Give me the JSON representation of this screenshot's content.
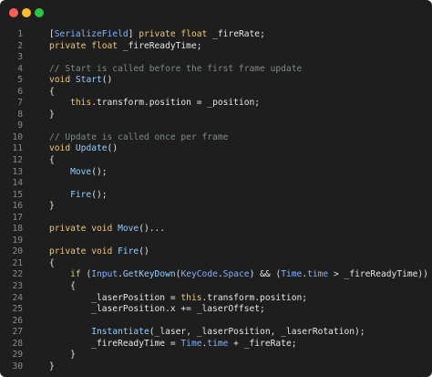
{
  "window": {
    "traffic_lights": {
      "close": "#ff5f57",
      "minimize": "#febc2e",
      "zoom": "#28c840"
    }
  },
  "code": {
    "lines": [
      {
        "n": "1",
        "segments": [
          {
            "t": "[",
            "c": "id"
          },
          {
            "t": "SerializeField",
            "c": "type"
          },
          {
            "t": "] ",
            "c": "id"
          },
          {
            "t": "private float",
            "c": "kw"
          },
          {
            "t": " _fireRate;",
            "c": "id"
          }
        ]
      },
      {
        "n": "2",
        "segments": [
          {
            "t": "private float",
            "c": "kw"
          },
          {
            "t": " _fireReadyTime;",
            "c": "id"
          }
        ]
      },
      {
        "n": "3",
        "segments": []
      },
      {
        "n": "4",
        "segments": [
          {
            "t": "// Start is called before the first frame update",
            "c": "com"
          }
        ]
      },
      {
        "n": "5",
        "segments": [
          {
            "t": "void",
            "c": "kw"
          },
          {
            "t": " ",
            "c": "id"
          },
          {
            "t": "Start",
            "c": "fn"
          },
          {
            "t": "()",
            "c": "id"
          }
        ]
      },
      {
        "n": "6",
        "segments": [
          {
            "t": "{",
            "c": "id"
          }
        ]
      },
      {
        "n": "7",
        "segments": [
          {
            "t": "    ",
            "c": "id"
          },
          {
            "t": "this",
            "c": "this"
          },
          {
            "t": ".transform.position = _position;",
            "c": "id"
          }
        ]
      },
      {
        "n": "8",
        "segments": [
          {
            "t": "}",
            "c": "id"
          }
        ]
      },
      {
        "n": "9",
        "segments": []
      },
      {
        "n": "10",
        "segments": [
          {
            "t": "// Update is called once per frame",
            "c": "com"
          }
        ]
      },
      {
        "n": "11",
        "segments": [
          {
            "t": "void",
            "c": "kw"
          },
          {
            "t": " ",
            "c": "id"
          },
          {
            "t": "Update",
            "c": "fn"
          },
          {
            "t": "()",
            "c": "id"
          }
        ]
      },
      {
        "n": "12",
        "segments": [
          {
            "t": "{",
            "c": "id"
          }
        ]
      },
      {
        "n": "13",
        "segments": [
          {
            "t": "    ",
            "c": "id"
          },
          {
            "t": "Move",
            "c": "fn"
          },
          {
            "t": "();",
            "c": "id"
          }
        ]
      },
      {
        "n": "14",
        "segments": []
      },
      {
        "n": "15",
        "segments": [
          {
            "t": "    ",
            "c": "id"
          },
          {
            "t": "Fire",
            "c": "fn"
          },
          {
            "t": "();",
            "c": "id"
          }
        ]
      },
      {
        "n": "16",
        "segments": [
          {
            "t": "}",
            "c": "id"
          }
        ]
      },
      {
        "n": "17",
        "segments": []
      },
      {
        "n": "18",
        "segments": [
          {
            "t": "private void",
            "c": "kw"
          },
          {
            "t": " ",
            "c": "id"
          },
          {
            "t": "Move",
            "c": "fn"
          },
          {
            "t": "()...",
            "c": "id"
          }
        ]
      },
      {
        "n": "19",
        "segments": []
      },
      {
        "n": "20",
        "segments": [
          {
            "t": "private void",
            "c": "kw"
          },
          {
            "t": " ",
            "c": "id"
          },
          {
            "t": "Fire",
            "c": "fn"
          },
          {
            "t": "()",
            "c": "id"
          }
        ]
      },
      {
        "n": "21",
        "segments": [
          {
            "t": "{",
            "c": "id"
          }
        ]
      },
      {
        "n": "22",
        "segments": [
          {
            "t": "    ",
            "c": "id"
          },
          {
            "t": "if",
            "c": "kw"
          },
          {
            "t": " (",
            "c": "id"
          },
          {
            "t": "Input",
            "c": "type"
          },
          {
            "t": ".",
            "c": "id"
          },
          {
            "t": "GetKeyDown",
            "c": "fn"
          },
          {
            "t": "(",
            "c": "id"
          },
          {
            "t": "KeyCode",
            "c": "type"
          },
          {
            "t": ".",
            "c": "id"
          },
          {
            "t": "Space",
            "c": "type"
          },
          {
            "t": ") && (",
            "c": "id"
          },
          {
            "t": "Time",
            "c": "type"
          },
          {
            "t": ".",
            "c": "id"
          },
          {
            "t": "time",
            "c": "type"
          },
          {
            "t": " > _fireReadyTime))",
            "c": "id"
          }
        ]
      },
      {
        "n": "23",
        "segments": [
          {
            "t": "    {",
            "c": "id"
          }
        ]
      },
      {
        "n": "24",
        "segments": [
          {
            "t": "        _laserPosition = ",
            "c": "id"
          },
          {
            "t": "this",
            "c": "this"
          },
          {
            "t": ".transform.position;",
            "c": "id"
          }
        ]
      },
      {
        "n": "25",
        "segments": [
          {
            "t": "        _laserPosition.x += _laserOffset;",
            "c": "id"
          }
        ]
      },
      {
        "n": "26",
        "segments": []
      },
      {
        "n": "27",
        "segments": [
          {
            "t": "        ",
            "c": "id"
          },
          {
            "t": "Instantiate",
            "c": "fn"
          },
          {
            "t": "(_laser, _laserPosition, _laserRotation);",
            "c": "id"
          }
        ]
      },
      {
        "n": "28",
        "segments": [
          {
            "t": "        _fireReadyTime = ",
            "c": "id"
          },
          {
            "t": "Time",
            "c": "type"
          },
          {
            "t": ".",
            "c": "id"
          },
          {
            "t": "time",
            "c": "type"
          },
          {
            "t": " + _fireRate;",
            "c": "id"
          }
        ]
      },
      {
        "n": "29",
        "segments": [
          {
            "t": "    }",
            "c": "id"
          }
        ]
      },
      {
        "n": "30",
        "segments": [
          {
            "t": "}",
            "c": "id"
          }
        ]
      }
    ]
  }
}
